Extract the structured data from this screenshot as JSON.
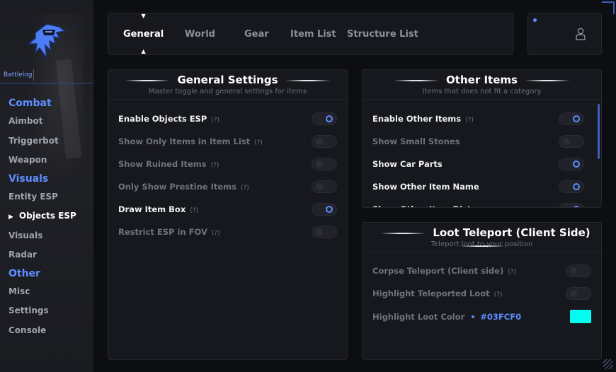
{
  "sidebar": {
    "brand": "Battlelog",
    "groups": [
      {
        "label": "Combat",
        "items": [
          "Aimbot",
          "Triggerbot",
          "Weapon"
        ]
      },
      {
        "label": "Visuals",
        "items": [
          "Entity ESP",
          "Objects ESP",
          "Visuals",
          "Radar"
        ]
      },
      {
        "label": "Other",
        "items": [
          "Misc",
          "Settings",
          "Console"
        ]
      }
    ],
    "active_item": "Objects ESP"
  },
  "tabs": [
    {
      "label": "General",
      "active": true
    },
    {
      "label": "World",
      "active": false
    },
    {
      "label": "Gear",
      "active": false
    },
    {
      "label": "Item List",
      "active": false
    },
    {
      "label": "Structure List",
      "active": false
    }
  ],
  "general": {
    "title": "General Settings",
    "subtitle": "Master toggle and general settings for items",
    "rows": [
      {
        "label": "Enable Objects ESP",
        "help": "(?)",
        "on": true
      },
      {
        "label": "Show Only Items in Item List",
        "help": "(?)",
        "on": false
      },
      {
        "label": "Show Ruined Items",
        "help": "(?)",
        "on": false
      },
      {
        "label": "Only Show Prestine Items",
        "help": "(?)",
        "on": false
      },
      {
        "label": "Draw Item Box",
        "help": "(?)",
        "on": true
      },
      {
        "label": "Restrict ESP in FOV",
        "help": "(?)",
        "on": false
      }
    ]
  },
  "other_items": {
    "title": "Other Items",
    "subtitle": "Items that does not fit a category",
    "rows": [
      {
        "label": "Enable Other Items",
        "help": "(?)",
        "on": true
      },
      {
        "label": "Show Small Stones",
        "help": "",
        "on": false
      },
      {
        "label": "Show Car Parts",
        "help": "",
        "on": true
      },
      {
        "label": "Show Other Item Name",
        "help": "",
        "on": true
      },
      {
        "label": "Show Other Item Dist",
        "help": "",
        "on": true
      }
    ]
  },
  "loot_teleport": {
    "title": "Loot Teleport (Client Side)",
    "subtitle": "Teleport loot to your position",
    "rows": [
      {
        "label": "Corpse Teleport (Client side)",
        "help": "(?)",
        "on": false
      },
      {
        "label": "Highlight Teleported Loot",
        "help": "(?)",
        "on": false
      }
    ],
    "color_label": "Highlight Loot Color",
    "color_hex": "#03FCF0",
    "color_value": "#03FCF0"
  },
  "colors": {
    "accent": "#5D8DFF",
    "bg": "#0D0E12",
    "panel": "#17181D"
  }
}
